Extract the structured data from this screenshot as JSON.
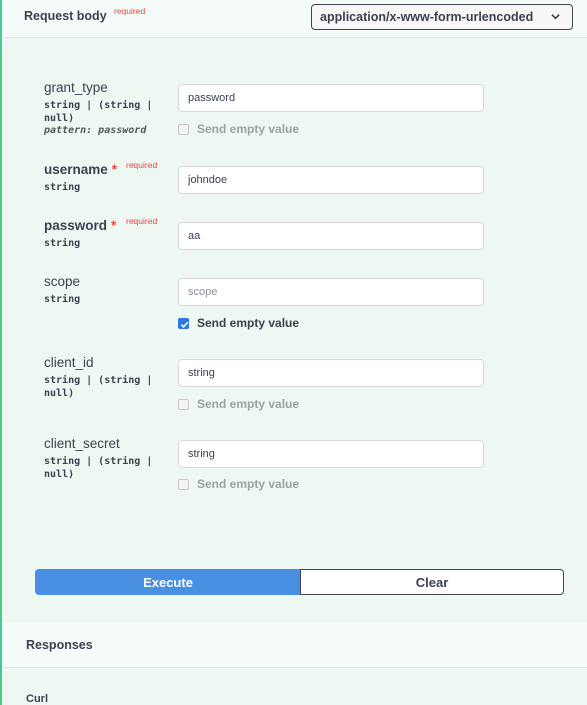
{
  "request_body": {
    "title": "Request body",
    "required_tag": "required",
    "content_type": "application/x-www-form-urlencoded"
  },
  "params": {
    "grant_type": {
      "name": "grant_type",
      "type_line1": "string | (string |",
      "type_line2": "null)",
      "pattern": "pattern: password",
      "value": "password",
      "send_empty_label": "Send empty value",
      "send_empty_checked": false
    },
    "username": {
      "name": "username",
      "star": "*",
      "required": "required",
      "type": "string",
      "value": "johndoe"
    },
    "password": {
      "name": "password",
      "star": "*",
      "required": "required",
      "type": "string",
      "value": "aa"
    },
    "scope": {
      "name": "scope",
      "type": "string",
      "value": "",
      "placeholder": "scope",
      "send_empty_label": "Send empty value",
      "send_empty_checked": true
    },
    "client_id": {
      "name": "client_id",
      "type_line1": "string | (string |",
      "type_line2": "null)",
      "value": "string",
      "send_empty_label": "Send empty value",
      "send_empty_checked": false
    },
    "client_secret": {
      "name": "client_secret",
      "type_line1": "string | (string |",
      "type_line2": "null)",
      "value": "string",
      "send_empty_label": "Send empty value",
      "send_empty_checked": false
    }
  },
  "actions": {
    "execute_label": "Execute",
    "clear_label": "Clear"
  },
  "responses": {
    "title": "Responses",
    "curl_label": "Curl"
  },
  "colors": {
    "accent_green": "#49cc90",
    "execute_blue": "#4990e2",
    "required_red": "#f93e3e",
    "checkbox_blue": "#2b78e4"
  }
}
